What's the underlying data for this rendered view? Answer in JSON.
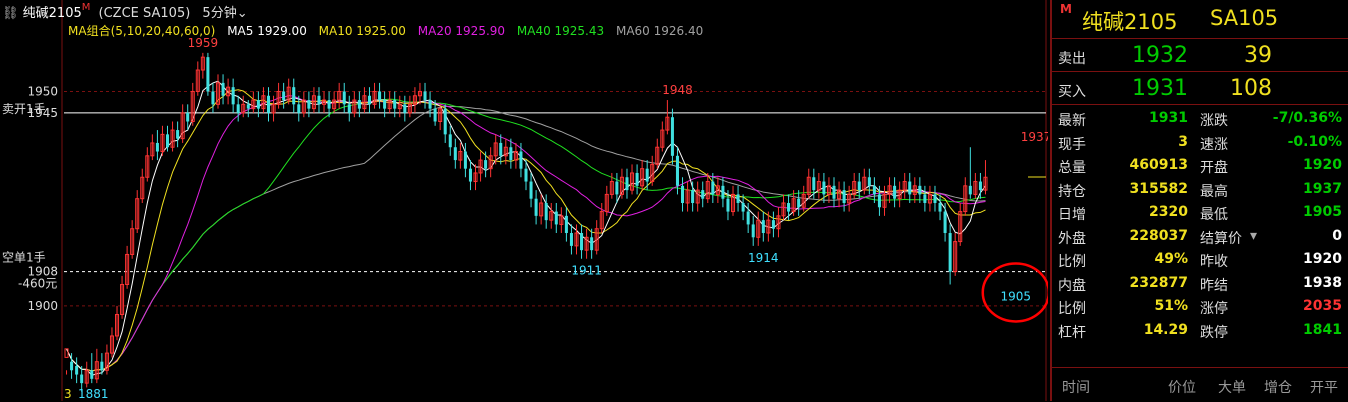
{
  "header": {
    "title": "纯碱2105",
    "flag": "M",
    "contract": "(CZCE SA105)",
    "period": "5分钟"
  },
  "ma_legend": {
    "group": "MA组合(5,10,20,40,60,0)",
    "items": [
      {
        "text": "MA5 1929.00",
        "color": "#ffffff"
      },
      {
        "text": "MA10 1925.00",
        "color": "#f0e020"
      },
      {
        "text": "MA20 1925.90",
        "color": "#e020e0"
      },
      {
        "text": "MA40 1925.43",
        "color": "#20e020"
      },
      {
        "text": "MA60 1926.40",
        "color": "#a0a0a0"
      }
    ]
  },
  "chart_data": {
    "type": "candlestick",
    "ylim": [
      1879,
      1962
    ],
    "y_ticks": [
      1950,
      1900
    ],
    "ref_lines": [
      {
        "value": 1945,
        "label": "1945",
        "side_label": "卖开1手",
        "style": "solid",
        "color": "#ffffff"
      },
      {
        "value": 1908,
        "label": "1908",
        "side_label": "空单1手",
        "extra_label": "-460元",
        "style": "dashed",
        "color": "#ffffff"
      }
    ],
    "annotations": [
      {
        "text": "1959",
        "index": 27,
        "value": 1959,
        "kind": "high",
        "color": "#ff4040"
      },
      {
        "text": "1948",
        "index": 121,
        "value": 1948,
        "kind": "high",
        "color": "#ff4040"
      },
      {
        "text": "1911",
        "index": 103,
        "value": 1911,
        "kind": "low",
        "color": "#40e0ff"
      },
      {
        "text": "1914",
        "index": 138,
        "value": 1914,
        "kind": "low",
        "color": "#40e0ff"
      },
      {
        "text": "1905",
        "index": 188,
        "value": 1905,
        "kind": "low",
        "color": "#40e0ff"
      },
      {
        "text": "1937",
        "index": 192,
        "value": 1937,
        "kind": "high",
        "color": "#ff4040"
      }
    ],
    "bottom_label_left": "3",
    "bottom_label": "1881",
    "candles": [
      [
        1888,
        1890,
        1885,
        1884
      ],
      [
        1887,
        1885,
        1889,
        1883
      ],
      [
        1886,
        1884,
        1888,
        1882
      ],
      [
        1884,
        1882,
        1886,
        1880
      ],
      [
        1882,
        1885,
        1887,
        1881
      ],
      [
        1885,
        1883,
        1889,
        1882
      ],
      [
        1883,
        1887,
        1890,
        1882
      ],
      [
        1887,
        1885,
        1889,
        1884
      ],
      [
        1885,
        1889,
        1891,
        1884
      ],
      [
        1889,
        1893,
        1895,
        1888
      ],
      [
        1893,
        1898,
        1900,
        1892
      ],
      [
        1898,
        1905,
        1907,
        1897
      ],
      [
        1905,
        1912,
        1914,
        1904
      ],
      [
        1912,
        1918,
        1920,
        1911
      ],
      [
        1918,
        1925,
        1927,
        1917
      ],
      [
        1925,
        1930,
        1932,
        1924
      ],
      [
        1930,
        1935,
        1937,
        1929
      ],
      [
        1935,
        1938,
        1940,
        1934
      ],
      [
        1938,
        1936,
        1941,
        1934
      ],
      [
        1936,
        1940,
        1942,
        1935
      ],
      [
        1940,
        1937,
        1942,
        1936
      ],
      [
        1937,
        1941,
        1943,
        1936
      ],
      [
        1941,
        1939,
        1943,
        1937
      ],
      [
        1939,
        1945,
        1947,
        1938
      ],
      [
        1945,
        1943,
        1947,
        1941
      ],
      [
        1943,
        1950,
        1952,
        1942
      ],
      [
        1950,
        1955,
        1957,
        1949
      ],
      [
        1955,
        1958,
        1959,
        1953
      ],
      [
        1958,
        1950,
        1959,
        1949
      ],
      [
        1950,
        1947,
        1952,
        1945
      ],
      [
        1947,
        1952,
        1954,
        1946
      ],
      [
        1952,
        1949,
        1954,
        1947
      ],
      [
        1949,
        1951,
        1953,
        1947
      ],
      [
        1951,
        1947,
        1953,
        1945
      ],
      [
        1947,
        1945,
        1949,
        1943
      ],
      [
        1945,
        1947,
        1949,
        1944
      ],
      [
        1947,
        1946,
        1948,
        1944
      ],
      [
        1946,
        1948,
        1950,
        1945
      ],
      [
        1948,
        1946,
        1950,
        1944
      ],
      [
        1946,
        1949,
        1951,
        1945
      ],
      [
        1949,
        1945,
        1951,
        1943
      ],
      [
        1945,
        1947,
        1949,
        1943
      ],
      [
        1947,
        1950,
        1952,
        1946
      ],
      [
        1950,
        1948,
        1952,
        1946
      ],
      [
        1948,
        1951,
        1953,
        1947
      ],
      [
        1951,
        1947,
        1953,
        1945
      ],
      [
        1947,
        1945,
        1949,
        1943
      ],
      [
        1945,
        1948,
        1950,
        1944
      ],
      [
        1948,
        1946,
        1950,
        1944
      ],
      [
        1946,
        1949,
        1951,
        1945
      ],
      [
        1949,
        1947,
        1951,
        1945
      ],
      [
        1947,
        1948,
        1950,
        1945
      ],
      [
        1948,
        1946,
        1950,
        1944
      ],
      [
        1946,
        1948,
        1950,
        1945
      ],
      [
        1948,
        1950,
        1952,
        1946
      ],
      [
        1950,
        1947,
        1952,
        1945
      ],
      [
        1947,
        1945,
        1949,
        1943
      ],
      [
        1945,
        1948,
        1950,
        1944
      ],
      [
        1948,
        1946,
        1950,
        1944
      ],
      [
        1946,
        1949,
        1951,
        1945
      ],
      [
        1949,
        1947,
        1951,
        1945
      ],
      [
        1947,
        1950,
        1952,
        1946
      ],
      [
        1950,
        1948,
        1952,
        1946
      ],
      [
        1948,
        1946,
        1950,
        1944
      ],
      [
        1946,
        1948,
        1950,
        1945
      ],
      [
        1948,
        1946,
        1950,
        1944
      ],
      [
        1946,
        1947,
        1949,
        1944
      ],
      [
        1947,
        1945,
        1949,
        1943
      ],
      [
        1945,
        1947,
        1949,
        1944
      ],
      [
        1947,
        1949,
        1951,
        1945
      ],
      [
        1949,
        1950,
        1952,
        1947
      ],
      [
        1950,
        1948,
        1952,
        1946
      ],
      [
        1948,
        1946,
        1950,
        1944
      ],
      [
        1946,
        1943,
        1948,
        1942
      ],
      [
        1943,
        1946,
        1947,
        1941
      ],
      [
        1946,
        1940,
        1947,
        1938
      ],
      [
        1940,
        1937,
        1942,
        1935
      ],
      [
        1937,
        1934,
        1939,
        1932
      ],
      [
        1934,
        1936,
        1938,
        1932
      ],
      [
        1936,
        1932,
        1938,
        1930
      ],
      [
        1932,
        1929,
        1934,
        1927
      ],
      [
        1929,
        1931,
        1933,
        1927
      ],
      [
        1931,
        1934,
        1936,
        1929
      ],
      [
        1934,
        1932,
        1936,
        1930
      ],
      [
        1932,
        1935,
        1937,
        1930
      ],
      [
        1935,
        1938,
        1940,
        1933
      ],
      [
        1938,
        1935,
        1940,
        1933
      ],
      [
        1935,
        1937,
        1939,
        1933
      ],
      [
        1937,
        1934,
        1939,
        1932
      ],
      [
        1934,
        1936,
        1938,
        1932
      ],
      [
        1936,
        1932,
        1938,
        1930
      ],
      [
        1932,
        1929,
        1934,
        1927
      ],
      [
        1929,
        1925,
        1931,
        1923
      ],
      [
        1925,
        1921,
        1927,
        1919
      ],
      [
        1921,
        1924,
        1926,
        1919
      ],
      [
        1924,
        1920,
        1926,
        1918
      ],
      [
        1920,
        1922,
        1924,
        1918
      ],
      [
        1922,
        1919,
        1924,
        1917
      ],
      [
        1919,
        1921,
        1923,
        1917
      ],
      [
        1921,
        1917,
        1923,
        1915
      ],
      [
        1917,
        1914,
        1919,
        1912
      ],
      [
        1914,
        1917,
        1919,
        1912
      ],
      [
        1917,
        1913,
        1919,
        1911
      ],
      [
        1913,
        1916,
        1918,
        1911
      ],
      [
        1916,
        1913,
        1918,
        1911
      ],
      [
        1913,
        1918,
        1920,
        1912
      ],
      [
        1918,
        1922,
        1924,
        1917
      ],
      [
        1922,
        1926,
        1928,
        1921
      ],
      [
        1926,
        1929,
        1931,
        1925
      ],
      [
        1929,
        1926,
        1931,
        1924
      ],
      [
        1926,
        1930,
        1932,
        1925
      ],
      [
        1930,
        1927,
        1932,
        1925
      ],
      [
        1927,
        1931,
        1933,
        1926
      ],
      [
        1931,
        1928,
        1933,
        1926
      ],
      [
        1928,
        1932,
        1934,
        1927
      ],
      [
        1932,
        1929,
        1934,
        1927
      ],
      [
        1929,
        1933,
        1935,
        1928
      ],
      [
        1933,
        1937,
        1939,
        1932
      ],
      [
        1937,
        1941,
        1943,
        1936
      ],
      [
        1941,
        1944,
        1948,
        1940
      ],
      [
        1944,
        1935,
        1946,
        1933
      ],
      [
        1935,
        1928,
        1937,
        1926
      ],
      [
        1928,
        1924,
        1930,
        1922
      ],
      [
        1924,
        1927,
        1929,
        1922
      ],
      [
        1927,
        1924,
        1929,
        1922
      ],
      [
        1924,
        1927,
        1929,
        1922
      ],
      [
        1927,
        1925,
        1929,
        1923
      ],
      [
        1925,
        1929,
        1931,
        1924
      ],
      [
        1929,
        1926,
        1931,
        1924
      ],
      [
        1926,
        1928,
        1930,
        1924
      ],
      [
        1928,
        1925,
        1930,
        1923
      ],
      [
        1925,
        1922,
        1927,
        1920
      ],
      [
        1922,
        1926,
        1928,
        1921
      ],
      [
        1926,
        1924,
        1928,
        1922
      ],
      [
        1924,
        1922,
        1926,
        1920
      ],
      [
        1922,
        1919,
        1924,
        1917
      ],
      [
        1919,
        1916,
        1921,
        1914
      ],
      [
        1916,
        1920,
        1922,
        1914
      ],
      [
        1920,
        1917,
        1922,
        1915
      ],
      [
        1917,
        1920,
        1922,
        1915
      ],
      [
        1920,
        1918,
        1922,
        1916
      ],
      [
        1918,
        1921,
        1923,
        1916
      ],
      [
        1921,
        1924,
        1926,
        1920
      ],
      [
        1924,
        1922,
        1926,
        1920
      ],
      [
        1922,
        1925,
        1927,
        1921
      ],
      [
        1925,
        1923,
        1927,
        1921
      ],
      [
        1923,
        1926,
        1928,
        1922
      ],
      [
        1926,
        1930,
        1932,
        1925
      ],
      [
        1930,
        1927,
        1932,
        1925
      ],
      [
        1927,
        1929,
        1931,
        1925
      ],
      [
        1929,
        1926,
        1931,
        1924
      ],
      [
        1926,
        1928,
        1930,
        1924
      ],
      [
        1928,
        1925,
        1930,
        1923
      ],
      [
        1925,
        1927,
        1929,
        1923
      ],
      [
        1927,
        1924,
        1929,
        1922
      ],
      [
        1924,
        1926,
        1928,
        1922
      ],
      [
        1926,
        1929,
        1931,
        1925
      ],
      [
        1929,
        1927,
        1931,
        1925
      ],
      [
        1927,
        1930,
        1932,
        1926
      ],
      [
        1930,
        1928,
        1932,
        1926
      ],
      [
        1928,
        1926,
        1930,
        1924
      ],
      [
        1926,
        1923,
        1928,
        1921
      ],
      [
        1923,
        1926,
        1928,
        1921
      ],
      [
        1926,
        1928,
        1930,
        1924
      ],
      [
        1928,
        1925,
        1930,
        1923
      ],
      [
        1925,
        1927,
        1929,
        1923
      ],
      [
        1927,
        1929,
        1931,
        1925
      ],
      [
        1929,
        1926,
        1931,
        1924
      ],
      [
        1926,
        1928,
        1930,
        1924
      ],
      [
        1928,
        1926,
        1930,
        1924
      ],
      [
        1926,
        1924,
        1928,
        1922
      ],
      [
        1924,
        1926,
        1928,
        1922
      ],
      [
        1926,
        1924,
        1928,
        1922
      ],
      [
        1924,
        1922,
        1926,
        1920
      ],
      [
        1922,
        1917,
        1924,
        1915
      ],
      [
        1917,
        1908,
        1919,
        1905
      ],
      [
        1908,
        1915,
        1917,
        1907
      ],
      [
        1915,
        1922,
        1924,
        1914
      ],
      [
        1922,
        1928,
        1930,
        1921
      ],
      [
        1928,
        1926,
        1937,
        1925
      ],
      [
        1926,
        1929,
        1931,
        1925
      ],
      [
        1929,
        1927,
        1931,
        1925
      ],
      [
        1927,
        1930,
        1934,
        1926
      ]
    ]
  },
  "quote": {
    "badge": "M",
    "name": "纯碱2105",
    "code": "SA105",
    "sell_label": "卖出",
    "sell_price": "1932",
    "sell_vol": "39",
    "buy_label": "买入",
    "buy_price": "1931",
    "buy_vol": "108",
    "rows": [
      {
        "l1": "最新",
        "v1": "1931",
        "c1": "c-green",
        "l2": "涨跌",
        "v2": "-7/0.36%",
        "c2": "c-green"
      },
      {
        "l1": "现手",
        "v1": "3",
        "c1": "c-yellow",
        "l2": "速涨",
        "v2": "-0.10%",
        "c2": "c-green"
      },
      {
        "l1": "总量",
        "v1": "460913",
        "c1": "c-yellow",
        "l2": "开盘",
        "v2": "1920",
        "c2": "c-green"
      },
      {
        "l1": "持仓",
        "v1": "315582",
        "c1": "c-yellow",
        "l2": "最高",
        "v2": "1937",
        "c2": "c-green"
      },
      {
        "l1": "日增",
        "v1": "2320",
        "c1": "c-yellow",
        "l2": "最低",
        "v2": "1905",
        "c2": "c-green"
      },
      {
        "l1": "外盘",
        "v1": "228037",
        "c1": "c-yellow",
        "l2": "结算价",
        "v2": "0",
        "c2": "c-white"
      },
      {
        "l1": "比例",
        "v1": "49%",
        "c1": "c-yellow",
        "l2": "昨收",
        "v2": "1920",
        "c2": "c-white"
      },
      {
        "l1": "内盘",
        "v1": "232877",
        "c1": "c-yellow",
        "l2": "昨结",
        "v2": "1938",
        "c2": "c-white"
      },
      {
        "l1": "比例",
        "v1": "51%",
        "c1": "c-yellow",
        "l2": "涨停",
        "v2": "2035",
        "c2": "c-red"
      },
      {
        "l1": "杠杆",
        "v1": "14.29",
        "c1": "c-yellow",
        "l2": "跌停",
        "v2": "1841",
        "c2": "c-green"
      }
    ],
    "footer": [
      "时间",
      "价位",
      "大单",
      "增仓",
      "开平"
    ]
  },
  "colors": {
    "up": "#ff3333",
    "down": "#40e0e0",
    "grid": "#7a1010",
    "ma5": "#ffffff",
    "ma10": "#f0e020",
    "ma20": "#e020e0",
    "ma40": "#20e020",
    "ma60": "#a0a0a0",
    "highlight": "#ff0000"
  }
}
